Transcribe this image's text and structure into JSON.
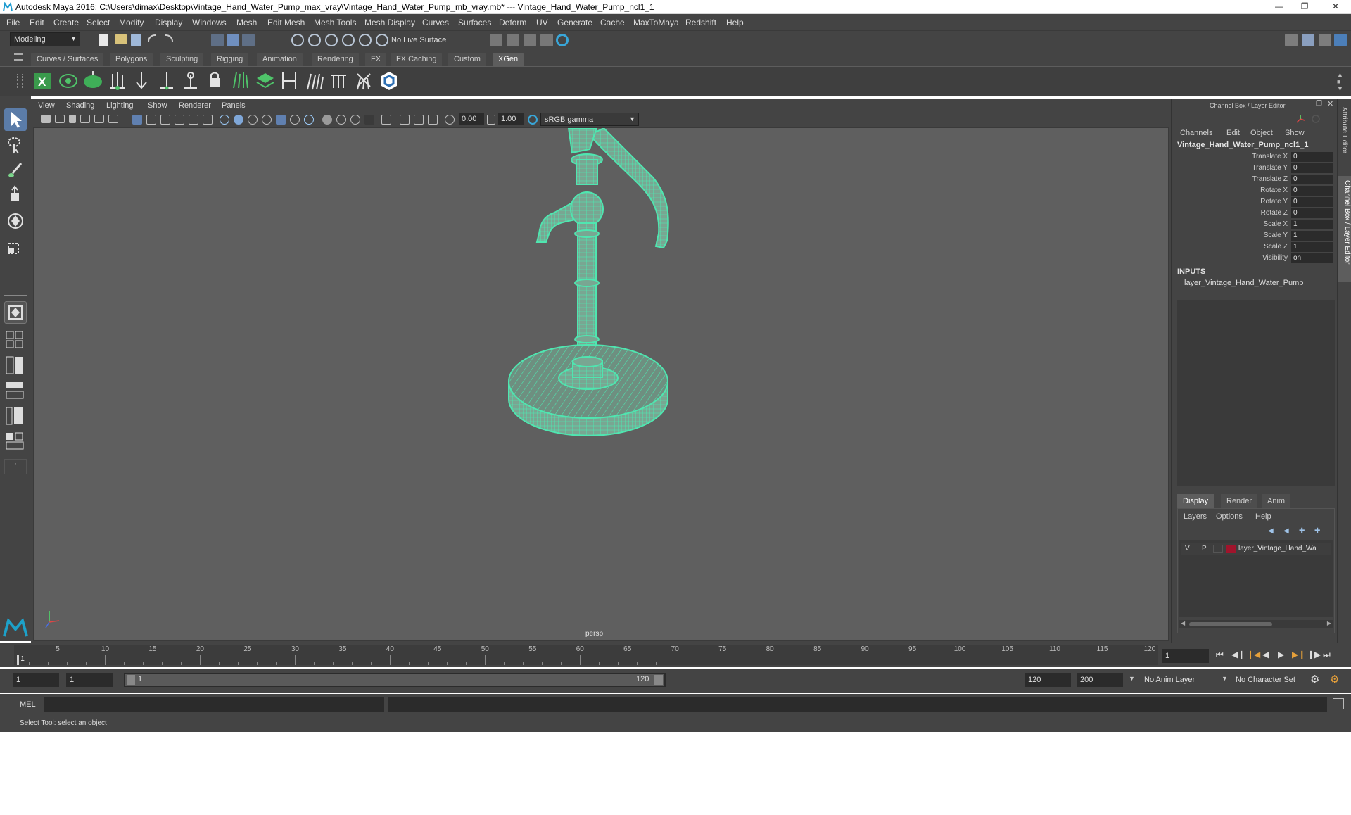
{
  "window": {
    "title": "Autodesk Maya 2016: C:\\Users\\dimax\\Desktop\\Vintage_Hand_Water_Pump_max_vray\\Vintage_Hand_Water_Pump_mb_vray.mb*  ---  Vintage_Hand_Water_Pump_ncl1_1"
  },
  "menubar": [
    "File",
    "Edit",
    "Create",
    "Select",
    "Modify",
    "Display",
    "Windows",
    "Mesh",
    "Edit Mesh",
    "Mesh Tools",
    "Mesh Display",
    "Curves",
    "Surfaces",
    "Deform",
    "UV",
    "Generate",
    "Cache",
    "MaxToMaya",
    "Redshift",
    "Help"
  ],
  "statusline": {
    "mode": "Modeling",
    "live_surface": "No Live Surface"
  },
  "shelf": {
    "tabs": [
      "Curves / Surfaces",
      "Polygons",
      "Sculpting",
      "Rigging",
      "Animation",
      "Rendering",
      "FX",
      "FX Caching",
      "Custom",
      "XGen"
    ],
    "active_tab": "XGen"
  },
  "viewport": {
    "menu": [
      "View",
      "Shading",
      "Lighting",
      "Show",
      "Renderer",
      "Panels"
    ],
    "exposure": "0.00",
    "gamma": "1.00",
    "color_space": "sRGB gamma",
    "camera_label": "persp"
  },
  "channel_box": {
    "header": "Channel Box / Layer Editor",
    "menu": [
      "Channels",
      "Edit",
      "Object",
      "Show"
    ],
    "object_name": "Vintage_Hand_Water_Pump_ncl1_1",
    "attributes": [
      {
        "name": "Translate X",
        "value": "0"
      },
      {
        "name": "Translate Y",
        "value": "0"
      },
      {
        "name": "Translate Z",
        "value": "0"
      },
      {
        "name": "Rotate X",
        "value": "0"
      },
      {
        "name": "Rotate Y",
        "value": "0"
      },
      {
        "name": "Rotate Z",
        "value": "0"
      },
      {
        "name": "Scale X",
        "value": "1"
      },
      {
        "name": "Scale Y",
        "value": "1"
      },
      {
        "name": "Scale Z",
        "value": "1"
      },
      {
        "name": "Visibility",
        "value": "on"
      }
    ],
    "inputs_label": "INPUTS",
    "inputs_item": "layer_Vintage_Hand_Water_Pump"
  },
  "layer_editor": {
    "tabs": [
      "Display",
      "Render",
      "Anim"
    ],
    "active_tab": "Display",
    "menu": [
      "Layers",
      "Options",
      "Help"
    ],
    "layer": {
      "v": "V",
      "p": "P",
      "name": "layer_Vintage_Hand_Wa",
      "color": "#a0142c"
    }
  },
  "side_tabs": [
    "Attribute Editor",
    "Channel Box / Layer Editor"
  ],
  "timeline": {
    "ticks": [
      "1",
      "5",
      "10",
      "15",
      "20",
      "25",
      "30",
      "35",
      "40",
      "45",
      "50",
      "55",
      "60",
      "65",
      "70",
      "75",
      "80",
      "85",
      "90",
      "95",
      "100",
      "105",
      "110",
      "115",
      "120"
    ],
    "current_frame": "1"
  },
  "range": {
    "start": "1",
    "playback_start": "1",
    "slider_start": "1",
    "slider_end": "120",
    "playback_end": "120",
    "end": "200",
    "anim_layer": "No Anim Layer",
    "character_set": "No Character Set"
  },
  "command_line": {
    "label": "MEL"
  },
  "help_line": "Select Tool: select an object",
  "colors": {
    "wire": "#4fe6b0",
    "panel": "#444444",
    "viewport": "#5f5f5f",
    "field": "#2b2b2b",
    "active_tab": "#5d5d5d"
  }
}
